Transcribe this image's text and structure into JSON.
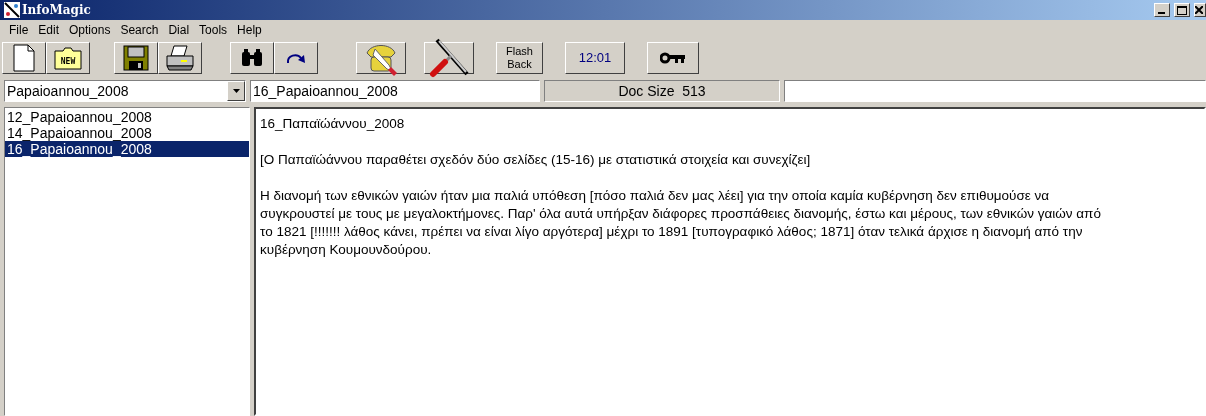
{
  "window": {
    "title": "InfoMagic"
  },
  "menu": [
    {
      "label": "File"
    },
    {
      "label": "Edit"
    },
    {
      "label": "Options"
    },
    {
      "label": "Search"
    },
    {
      "label": "Dial"
    },
    {
      "label": "Tools"
    },
    {
      "label": "Help"
    }
  ],
  "toolbar": [
    {
      "kind": "icon"
    },
    {
      "kind": "folder",
      "label": "NEW"
    },
    {
      "kind": "icon"
    },
    {
      "kind": "icon"
    },
    {
      "kind": "icon"
    },
    {
      "kind": "icon"
    },
    {
      "kind": "icon"
    },
    {
      "kind": "icon"
    },
    {
      "kind": "text",
      "label": "Flash Back"
    },
    {
      "kind": "clock",
      "label": "12:01"
    },
    {
      "kind": "icon"
    }
  ],
  "document_selector": {
    "value": "Papaioannou_2008"
  },
  "title_field": {
    "value": "16_Papaioannou_2008"
  },
  "doc_size": "Doc Size  513",
  "documents": [
    {
      "label": "12_Papaioannou_2008",
      "selected": false
    },
    {
      "label": "14_Papaioannou_2008",
      "selected": false
    },
    {
      "label": "16_Papaioannou_2008",
      "selected": true
    }
  ],
  "document": {
    "heading": "16_Παπαϊώάννου_2008",
    "paragraphs": [
      "[Ο Παπαϊώάννου παραθέτει σχεδόν δύο σελίδες (15-16) με στατιστικά στοιχεία και συνεχίζει]",
      "Η διανομή των εθνικών γαιών ήταν μια παλιά υπόθεση [πόσο παλιά δεν μας λέει] για την οποία καμία κυβέρνηση δεν επιθυμούσε να συγκρουστεί με τους με μεγαλοκτήμονες. Παρ' όλα αυτά υπήρξαν διάφορες προσπάθειες διανομής, έστω και μέρους, των εθνικών γαιών από το 1821 [!!!!!!! λάθος κάνει, πρέπει να είναι λίγο αργότερα] μέχρι το 1891 [τυπογραφικό λάθος; 1871] όταν τελικά άρχισε η διανομή από την κυβέρνηση Κουμουνδούρου."
    ]
  }
}
